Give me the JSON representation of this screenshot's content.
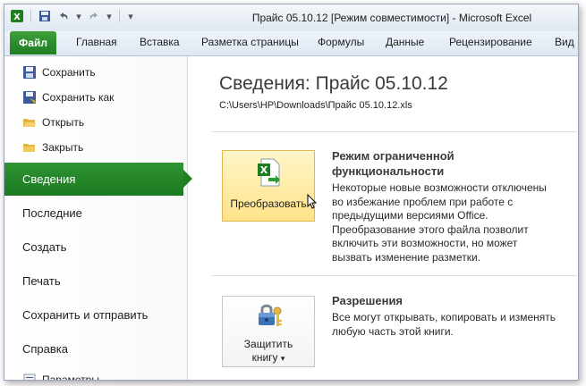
{
  "window": {
    "title": "Прайс 05.10.12  [Режим совместимости]  -  Microsoft Excel"
  },
  "ribbon": {
    "file_tab": "Файл",
    "tabs": [
      "Главная",
      "Вставка",
      "Разметка страницы",
      "Формулы",
      "Данные",
      "Рецензирование",
      "Вид"
    ]
  },
  "backstage": {
    "commands": [
      "Сохранить",
      "Сохранить как",
      "Открыть",
      "Закрыть"
    ],
    "active_tab": "Сведения",
    "tabs": [
      "Последние",
      "Создать",
      "Печать",
      "Сохранить и отправить",
      "Справка",
      "Параметры"
    ]
  },
  "info": {
    "title": "Сведения: Прайс 05.10.12",
    "path": "C:\\Users\\HP\\Downloads\\Прайс 05.10.12.xls",
    "convert": {
      "button_label": "Преобразовать",
      "heading_line1": "Режим ограниченной",
      "heading_line2": "функциональности",
      "lines": [
        "Некоторые новые возможности отключены",
        "во избежание проблем при работе с",
        "предыдущими версиями Office.",
        "Преобразование этого файла позволит",
        "включить эти возможности, но может",
        "вызвать изменение разметки."
      ]
    },
    "protect": {
      "button_line1": "Защитить",
      "button_line2": "книгу",
      "heading": "Разрешения",
      "lines": [
        "Все могут открывать, копировать и изменять",
        "любую часть этой книги."
      ]
    }
  },
  "colors": {
    "accent_green": "#1f7d21",
    "highlight_yellow": "#ffe28a"
  }
}
